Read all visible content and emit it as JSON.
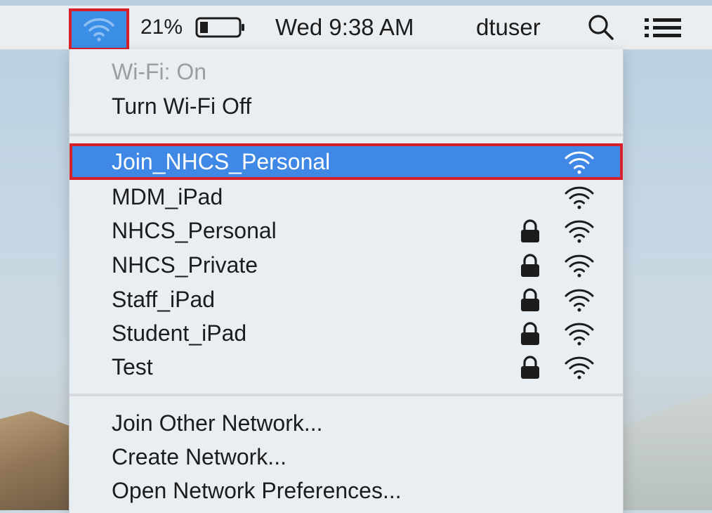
{
  "menubar": {
    "battery_percent": "21%",
    "battery_level": 0.21,
    "clock": "Wed 9:38 AM",
    "user": "dtuser",
    "icons": [
      "wifi-icon",
      "battery-icon",
      "search-icon",
      "list-icon"
    ]
  },
  "wifi_menu": {
    "status": "Wi-Fi: On",
    "toggle": "Turn Wi-Fi Off",
    "networks": [
      {
        "name": "Join_NHCS_Personal",
        "locked": false,
        "highlighted": true
      },
      {
        "name": "MDM_iPad",
        "locked": false
      },
      {
        "name": "NHCS_Personal",
        "locked": true
      },
      {
        "name": "NHCS_Private",
        "locked": true
      },
      {
        "name": "Staff_iPad",
        "locked": true
      },
      {
        "name": "Student_iPad",
        "locked": true
      },
      {
        "name": "Test",
        "locked": true
      }
    ],
    "actions": {
      "join_other": "Join Other Network...",
      "create": "Create Network...",
      "preferences": "Open Network Preferences..."
    }
  },
  "colors": {
    "highlight": "#3f88e6",
    "annotation_border": "#d6202c",
    "menu_background": "#e9eef2"
  }
}
